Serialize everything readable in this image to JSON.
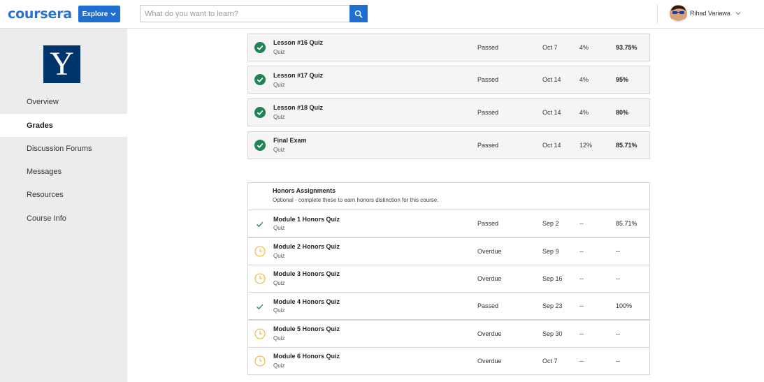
{
  "header": {
    "logo": "coursera",
    "explore_label": "Explore",
    "search_placeholder": "What do you want to learn?",
    "user_name": "Rihad Variawa"
  },
  "sidebar": {
    "logo_letter": "Y",
    "items": [
      {
        "label": "Overview",
        "active": false
      },
      {
        "label": "Grades",
        "active": true
      },
      {
        "label": "Discussion Forums",
        "active": false
      },
      {
        "label": "Messages",
        "active": false
      },
      {
        "label": "Resources",
        "active": false
      },
      {
        "label": "Course Info",
        "active": false
      }
    ]
  },
  "graded": [
    {
      "name": "Lesson #16 Quiz",
      "type": "Quiz",
      "status": "Passed",
      "due": "Oct 7",
      "weight": "4%",
      "grade": "93.75%"
    },
    {
      "name": "Lesson #17 Quiz",
      "type": "Quiz",
      "status": "Passed",
      "due": "Oct 14",
      "weight": "4%",
      "grade": "95%"
    },
    {
      "name": "Lesson #18 Quiz",
      "type": "Quiz",
      "status": "Passed",
      "due": "Oct 14",
      "weight": "4%",
      "grade": "80%"
    },
    {
      "name": "Final Exam",
      "type": "Quiz",
      "status": "Passed",
      "due": "Oct 14",
      "weight": "12%",
      "grade": "85.71%"
    }
  ],
  "honors": {
    "title": "Honors Assignments",
    "subtitle": "Optional - complete these to earn honors distinction for this course.",
    "items": [
      {
        "name": "Module 1 Honors Quiz",
        "type": "Quiz",
        "status": "Passed",
        "due": "Sep 2",
        "weight": "--",
        "grade": "85.71%",
        "icon": "check"
      },
      {
        "name": "Module 2 Honors Quiz",
        "type": "Quiz",
        "status": "Overdue",
        "due": "Sep 9",
        "weight": "--",
        "grade": "--",
        "icon": "clock"
      },
      {
        "name": "Module 3 Honors Quiz",
        "type": "Quiz",
        "status": "Overdue",
        "due": "Sep 16",
        "weight": "--",
        "grade": "--",
        "icon": "clock"
      },
      {
        "name": "Module 4 Honors Quiz",
        "type": "Quiz",
        "status": "Passed",
        "due": "Sep 23",
        "weight": "--",
        "grade": "100%",
        "icon": "check"
      },
      {
        "name": "Module 5 Honors Quiz",
        "type": "Quiz",
        "status": "Overdue",
        "due": "Sep 30",
        "weight": "--",
        "grade": "--",
        "icon": "clock"
      },
      {
        "name": "Module 6 Honors Quiz",
        "type": "Quiz",
        "status": "Overdue",
        "due": "Oct 7",
        "weight": "--",
        "grade": "--",
        "icon": "clock"
      }
    ]
  },
  "colors": {
    "brand": "#2a73cc",
    "button": "#1f6fd1",
    "passed": "#1f8354",
    "overdue": "#f2b438",
    "yale": "#00356b"
  }
}
